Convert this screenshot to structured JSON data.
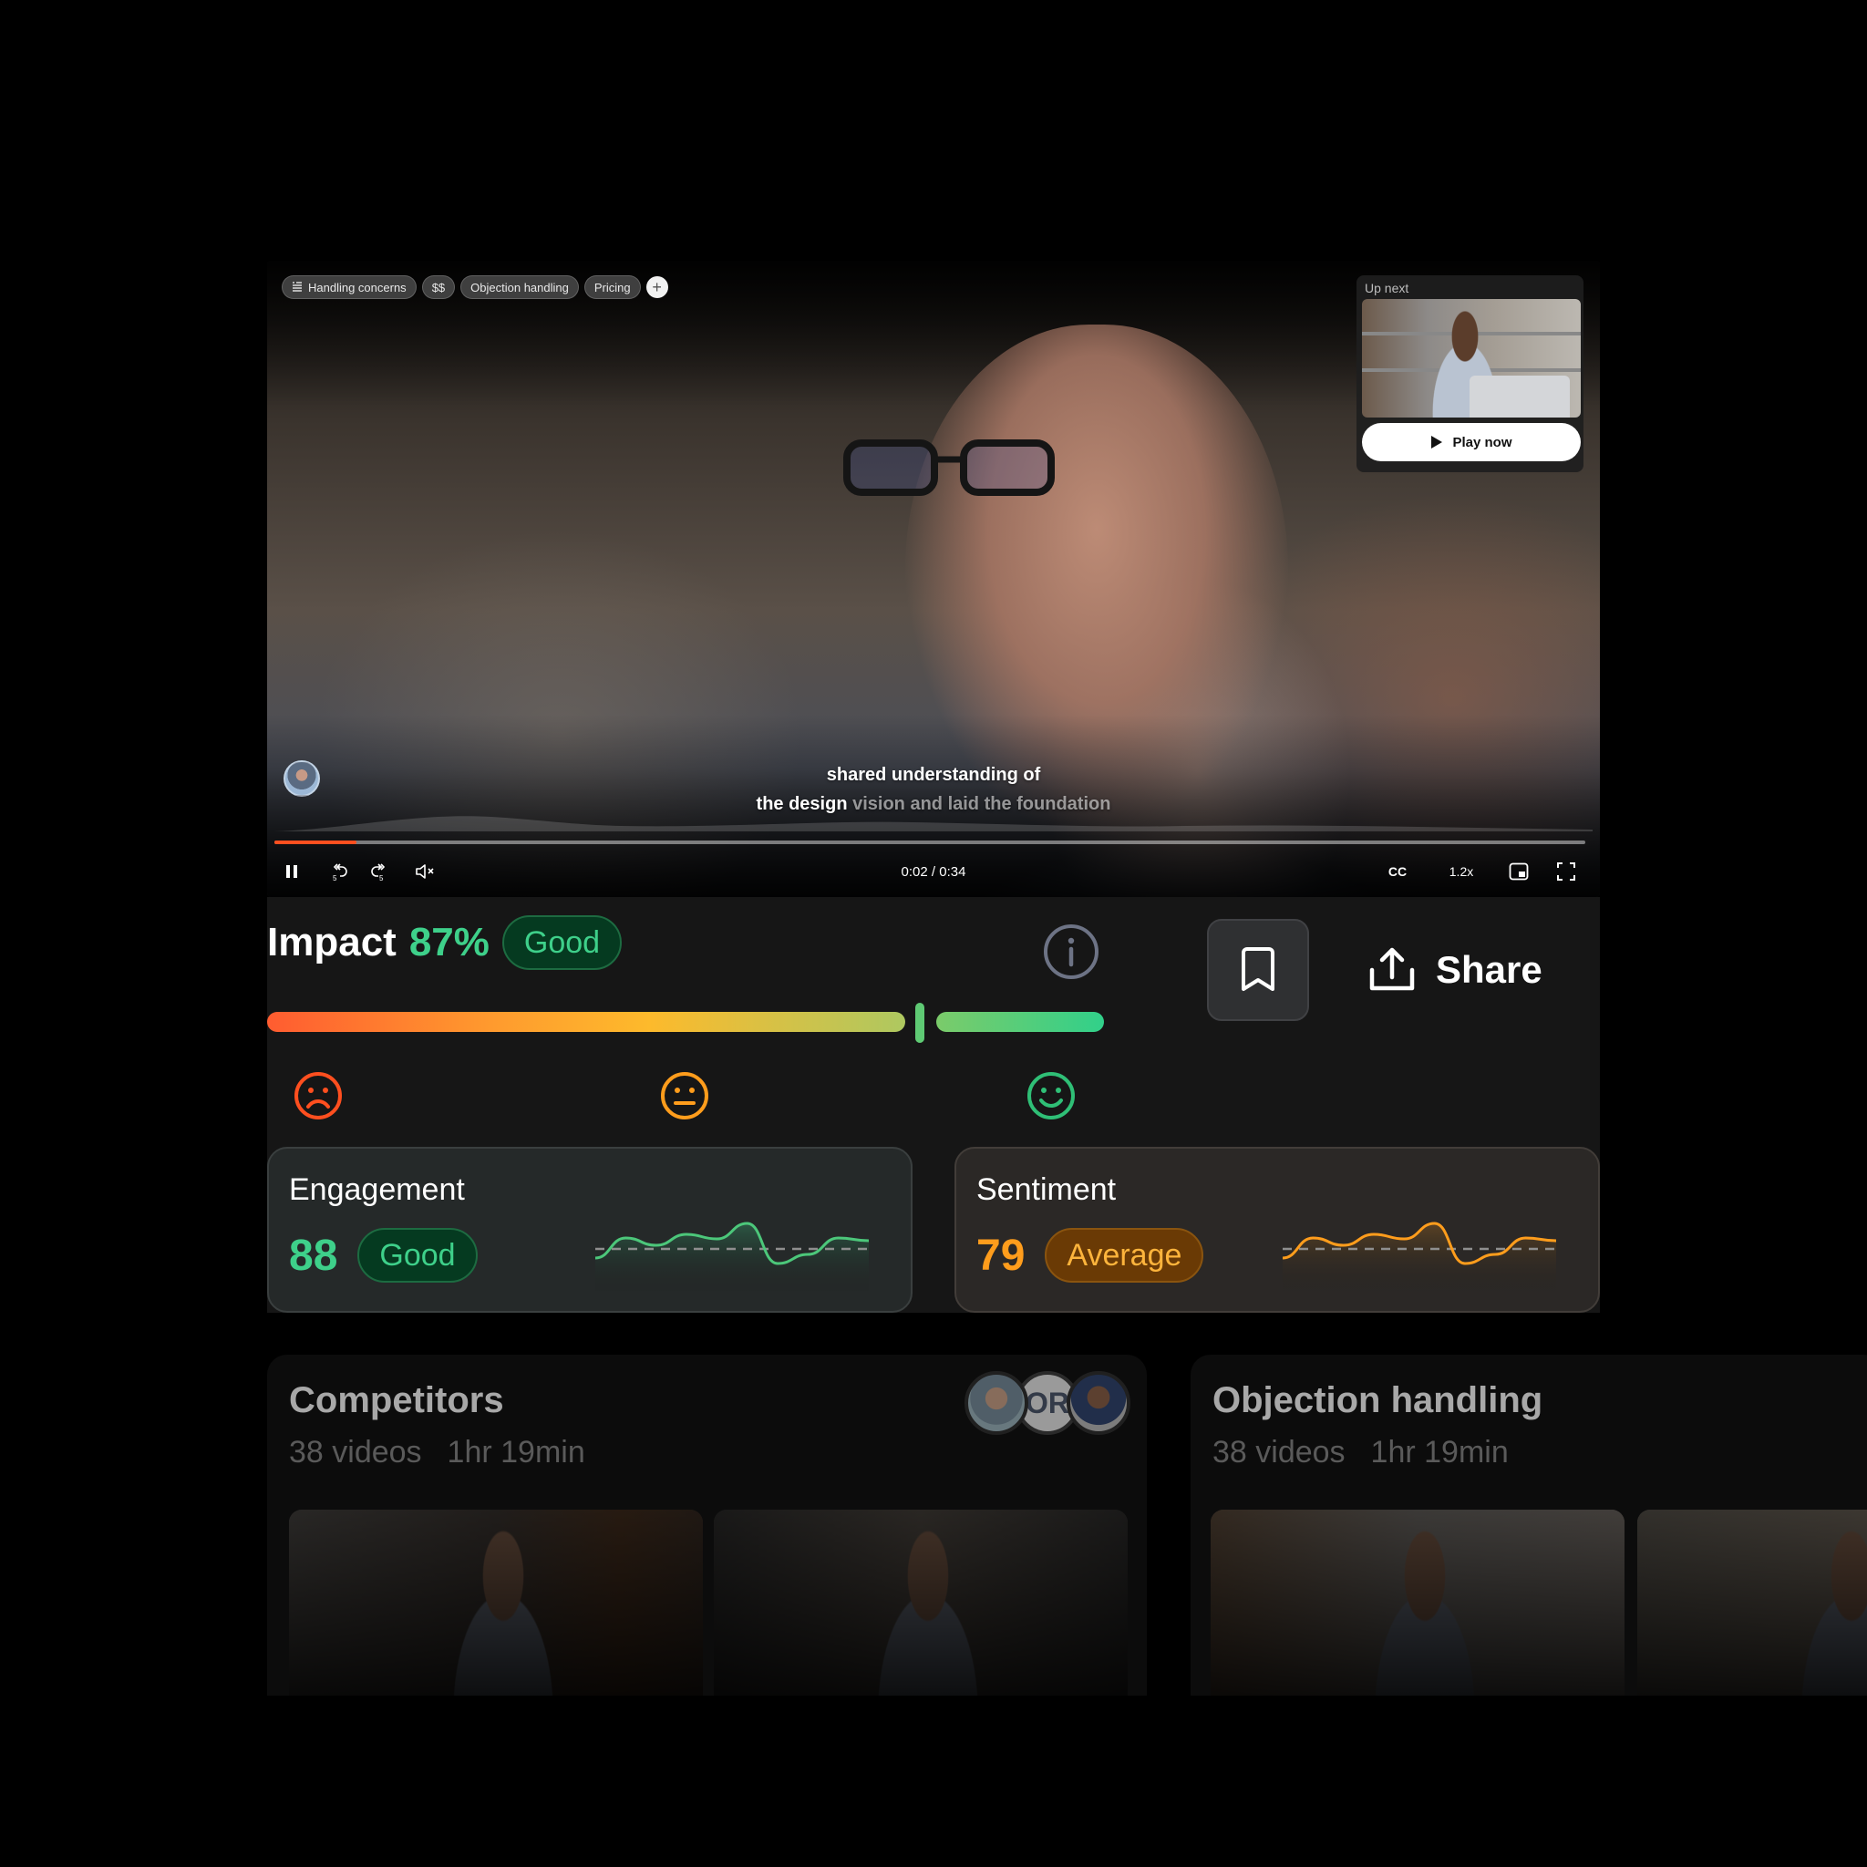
{
  "player": {
    "tags": [
      {
        "label": "Handling concerns",
        "icon": "chapter-list-icon"
      },
      {
        "label": "$$"
      },
      {
        "label": "Objection handling"
      },
      {
        "label": "Pricing"
      }
    ],
    "add_tag_label": "+",
    "up_next": {
      "label": "Up next",
      "play_label": "Play now"
    },
    "subtitle": {
      "line1": "shared understanding of",
      "line2_spoken": "the design",
      "line2_upcoming": "vision and laid the foundation"
    },
    "progress_fraction": 0.0625,
    "time": "0:02 / 0:34",
    "cc_label": "CC",
    "speed_label": "1.2x",
    "skip_back_seconds": "5",
    "skip_forward_seconds": "5"
  },
  "impact": {
    "label": "Impact",
    "percent": "87%",
    "rating": "Good",
    "score_fraction": 0.87,
    "share_label": "Share",
    "colors": {
      "good": "#3ed08a",
      "average": "#ff9d1c",
      "bad": "#ff4f1f"
    }
  },
  "metrics": [
    {
      "label": "Engagement",
      "value": "88",
      "rating": "Good",
      "color": "#4cc77a",
      "fill": "rgba(62,208,138,0.28)",
      "series": [
        40,
        62,
        54,
        66,
        61,
        78,
        34,
        44,
        62,
        59
      ],
      "baseline": 50
    },
    {
      "label": "Sentiment",
      "value": "79",
      "rating": "Average",
      "color": "#ff9d1c",
      "fill": "rgba(255,157,28,0.22)",
      "series": [
        40,
        62,
        54,
        66,
        61,
        78,
        34,
        44,
        62,
        59
      ],
      "baseline": 50
    }
  ],
  "playlists": [
    {
      "title": "Competitors",
      "video_count": "38 videos",
      "duration": "1hr 19min",
      "avatar_initials": "OR"
    },
    {
      "title": "Objection handling",
      "video_count": "38 videos",
      "duration": "1hr 19min"
    }
  ]
}
